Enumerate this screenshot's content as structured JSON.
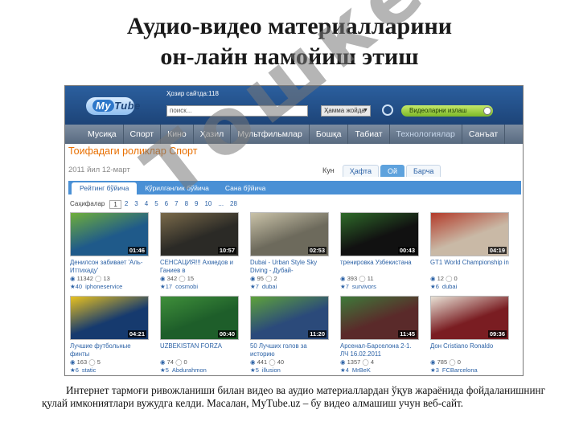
{
  "slide": {
    "title_line1": "Аудио-видео материалларини",
    "title_line2": "он-лайн намойиш этиш",
    "caption": "Интернет тармоғи ривожланиши билан видео ва аудио материаллардан ўқув жараёнида фойдаланишнинг қулай имкониятлари вужудга келди. Масалан, MyTube.uz – бу видео алмашиш учун веб-сайт.",
    "watermark": "Тошкент"
  },
  "site": {
    "logo_my": "My",
    "logo_tube": "Tube",
    "online": "Ҳозир сайтда:118",
    "search_placeholder": "поиск...",
    "scope": "Ҳамма жойда",
    "video_toggle": "Видеоларни излаш"
  },
  "nav": [
    "Мусиқа",
    "Спорт",
    "Кино",
    "Ҳазил",
    "Мультфильмлар",
    "Бошқа",
    "Табиат",
    "Технологиялар",
    "Санъат"
  ],
  "nav_active_index": 7,
  "category": {
    "title": "Тоифадаги роликлар Спорт",
    "date": "2011 йил 12-март"
  },
  "period_tabs": [
    "Кун",
    "Ҳафта",
    "Ой",
    "Барча"
  ],
  "period_active_index": 2,
  "sort_tabs": [
    "Рейтинг бўйича",
    "Кўрилганлик бўйича",
    "Сана бўйича"
  ],
  "sort_active_index": 0,
  "pager": {
    "label": "Саҳифалар",
    "pages": [
      "1",
      "2",
      "3",
      "4",
      "5",
      "6",
      "7",
      "8",
      "9",
      "10",
      "...",
      "28"
    ],
    "current_index": 0
  },
  "videos": [
    {
      "title": "Денилсон забивает 'Аль-Иттихаду'",
      "duration": "01:46",
      "views": "11342",
      "comments": "13",
      "rating": "40",
      "author": "iphoneservice",
      "bg": "#1f5a8a",
      "fg": "#6fae3a"
    },
    {
      "title": "СЕНСАЦИЯ!!! Ахмедов и Ганиев в",
      "duration": "10:57",
      "views": "342",
      "comments": "15",
      "rating": "17",
      "author": "cosmobi",
      "bg": "#2b2a26",
      "fg": "#7a6a4a"
    },
    {
      "title": "Dubai - Urban Style Sky Diving - Дубай-",
      "duration": "02:53",
      "views": "95",
      "comments": "2",
      "rating": "7",
      "author": "dubai",
      "bg": "#6d6a5c",
      "fg": "#c9c2a8"
    },
    {
      "title": "тренировка Узбекистана",
      "duration": "00:43",
      "views": "393",
      "comments": "11",
      "rating": "7",
      "author": "survivors",
      "bg": "#111111",
      "fg": "#2f6b2a"
    },
    {
      "title": "GT1 World Championship in",
      "duration": "04:19",
      "views": "12",
      "comments": "0",
      "rating": "6",
      "author": "dubai",
      "bg": "#c9b9a6",
      "fg": "#b33b2a"
    },
    {
      "title": "Лучшие футбольные финты",
      "duration": "04:21",
      "views": "163",
      "comments": "5",
      "rating": "6",
      "author": "static",
      "bg": "#163a6e",
      "fg": "#e9c21f"
    },
    {
      "title": "UZBEKISTAN FORZA",
      "duration": "00:40",
      "views": "74",
      "comments": "0",
      "rating": "5",
      "author": "Abdurahmon",
      "bg": "#1e5e2a",
      "fg": "#3f8f3a"
    },
    {
      "title": "50 Лучших голов за историю",
      "duration": "11:20",
      "views": "441",
      "comments": "40",
      "rating": "5",
      "author": "illusion",
      "bg": "#2b4a7a",
      "fg": "#5ea23a"
    },
    {
      "title": "Арсенал-Барселона 2-1. ЛЧ 16.02.2011",
      "duration": "11:45",
      "views": "1357",
      "comments": "4",
      "rating": "4",
      "author": "MrBeK",
      "bg": "#5a2a2a",
      "fg": "#3e7a3a"
    },
    {
      "title": "Дон Cristiano Ronaldo",
      "duration": "09:36",
      "views": "785",
      "comments": "0",
      "rating": "3",
      "author": "FCBarcelona",
      "bg": "#7a1d22",
      "fg": "#e8e2d6"
    }
  ]
}
